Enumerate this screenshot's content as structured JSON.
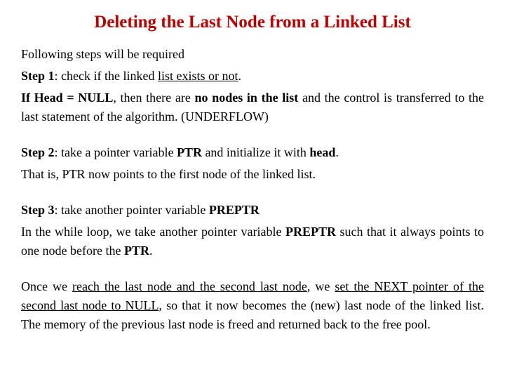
{
  "title": "Deleting the Last Node from a Linked List",
  "intro": "Following steps will be required",
  "step1": {
    "label": "Step 1",
    "colon_space": ":  ",
    "t1": "check if the linked ",
    "u1": "list exists or not",
    "period": "."
  },
  "step1b": {
    "b1": "If Head = NULL",
    "t1": ", then there are ",
    "b2": "no nodes in the list",
    "t2": " and the control is transferred to the last statement of the algorithm. (UNDERFLOW)"
  },
  "step2": {
    "label": "Step 2",
    "t1": ": take a pointer variable ",
    "b1": "PTR",
    "t2": " and initialize it with ",
    "b2": "head",
    "period": "."
  },
  "step2b": "That is, PTR now points to the first node of the linked list.",
  "step3": {
    "label": "Step 3",
    "t1": ": take another pointer variable ",
    "b1": "PREPTR"
  },
  "step3b": {
    "t1": "In the while loop, we take another pointer variable ",
    "b1": "PREPTR",
    "t2": " such that it always points to one node before the ",
    "b2": "PTR",
    "period": "."
  },
  "final": {
    "t1": "Once we ",
    "u1": "reach the last node and the second last node",
    "t2": ", we ",
    "u2": "set the NEXT pointer of the second last node to NULL",
    "t3": ", so that it now becomes the (new) last node of the linked list. The memory of the previous last node is freed and returned back to the free pool."
  }
}
